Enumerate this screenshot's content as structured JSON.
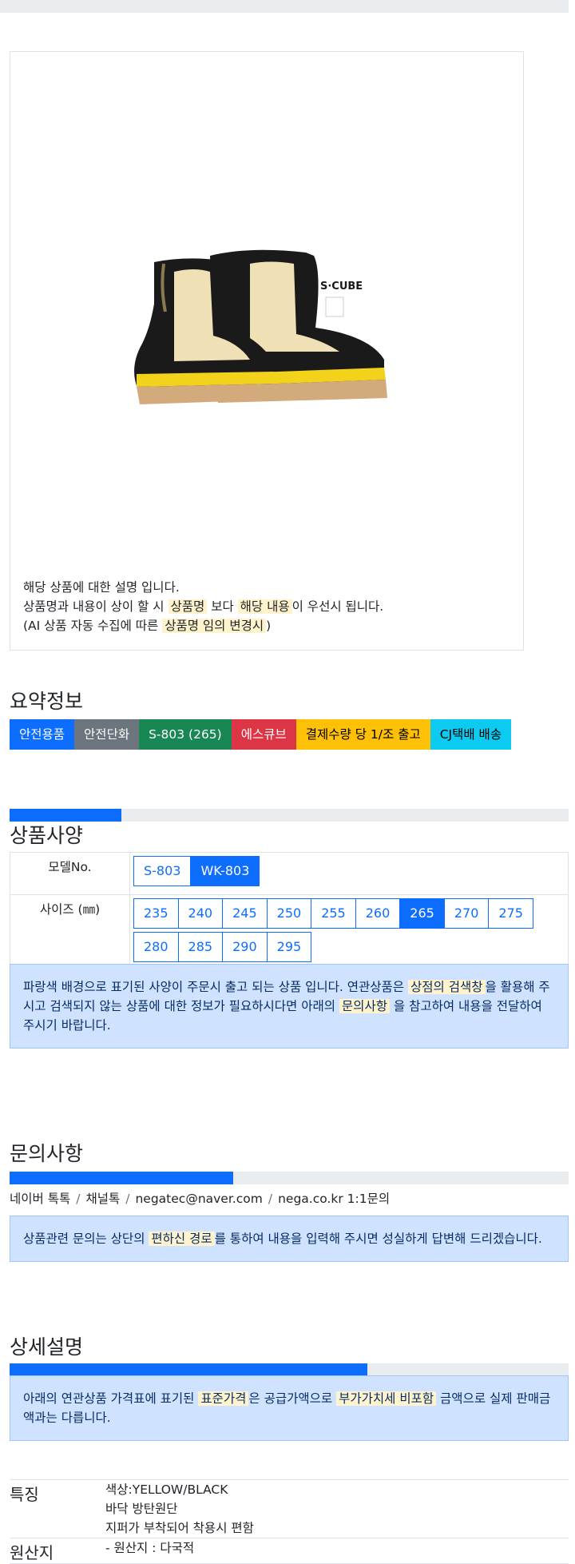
{
  "product_box": {
    "image_alt": "S-CUBE safety boots",
    "brand_mark": "S·CUBE",
    "desc_line1": "해당 상품에 대한 설명 입니다.",
    "desc_line2_a": "상품명과 내용이 상이 할 시 ",
    "desc_line2_h1": "상품명",
    "desc_line2_b": " 보다 ",
    "desc_line2_h2": "해당 내용",
    "desc_line2_c": "이 우선시 됩니다.",
    "desc_line3_a": "(AI 상품 자동 수집에 따른 ",
    "desc_line3_h": "상품명 임의 변경시",
    "desc_line3_b": ")"
  },
  "summary": {
    "title": "요약정보",
    "badges": [
      "안전용품",
      "안전단화",
      "S-803 (265)",
      "에스큐브",
      "결제수량 당 1/조 출고",
      "CJ택배 배송"
    ]
  },
  "spec": {
    "title": "상품사양",
    "progress": 0.2,
    "model_label": "모델No.",
    "models": [
      "S-803",
      "WK-803"
    ],
    "selected_model": "WK-803",
    "size_label": "사이즈 (㎜)",
    "sizes": [
      "235",
      "240",
      "245",
      "250",
      "255",
      "260",
      "265",
      "270",
      "275",
      "280",
      "285",
      "290",
      "295"
    ],
    "selected_size": "265",
    "notice_a": "파랑색 배경으로 표기된 사양이 주문시 출고 되는 상품 입니다. 연관상품은 ",
    "notice_h1": "상점의 검색창",
    "notice_b": "을 활용해 주시고 검색되지 않는 상품에 대한 정보가 필요하시다면 아래의 ",
    "notice_h2": "문의사항",
    "notice_c": " 을 참고하여 내용을 전달하여 주시기 바랍니다."
  },
  "inquiry": {
    "title": "문의사항",
    "progress": 0.4,
    "links": [
      "네이버 톡톡",
      "채널톡",
      "negatec@naver.com",
      "nega.co.kr 1:1문의"
    ],
    "notice_a": "상품관련 문의는 상단의 ",
    "notice_h": "편하신 경로",
    "notice_b": "를 통하여 내용을 입력해 주시면 성실하게 답변해 드리겠습니다."
  },
  "detail": {
    "title": "상세설명",
    "progress": 0.64,
    "notice_a": "아래의 연관상품 가격표에 표기된 ",
    "notice_h1": "표준가격",
    "notice_b": "은 공급가액으로 ",
    "notice_h2": "부가가치세 비포함",
    "notice_c": " 금액으로 실제 판매금액과는 다릅니다."
  },
  "features": {
    "feature_label": "특징",
    "feature_lines": [
      "색상:YELLOW/BLACK",
      "바닥 방탄원단",
      "지퍼가 부착되어 착용시 편함"
    ],
    "origin_label": "원산지",
    "origin_lines": [
      "- 원산지 : 다국적"
    ]
  }
}
